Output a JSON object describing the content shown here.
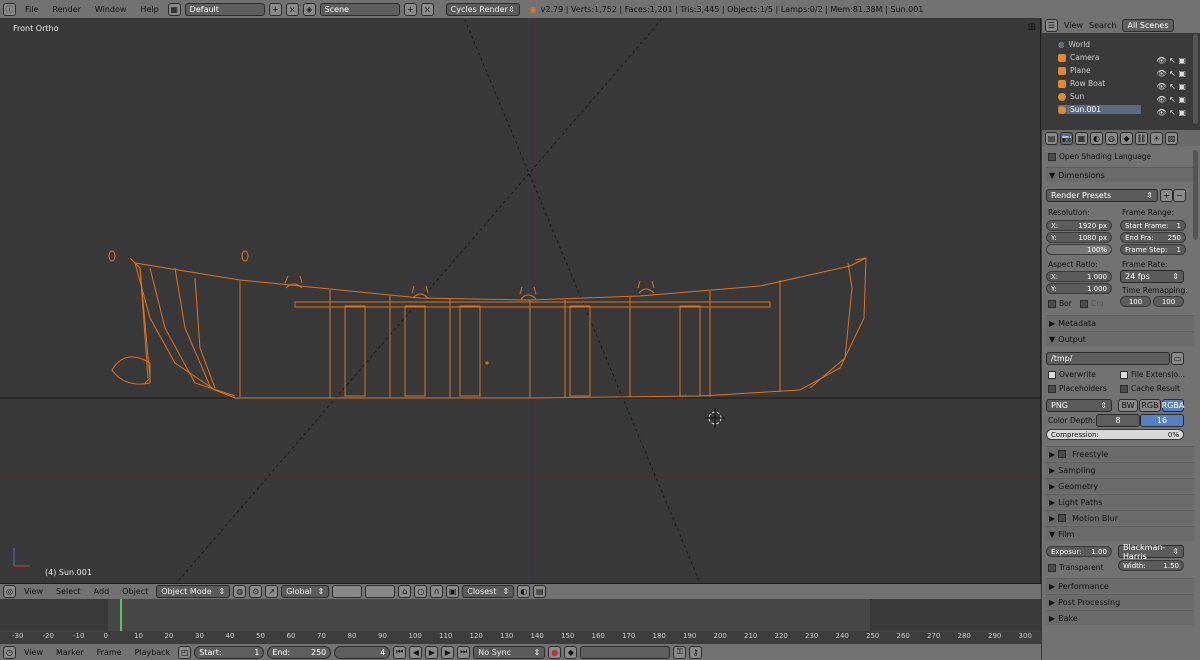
{
  "topbar": {
    "menus": [
      "File",
      "Render",
      "Window",
      "Help"
    ],
    "layout": "Default",
    "scene": "Scene",
    "engine": "Cycles Render",
    "stats": "v2.79 | Verts:1,752 | Faces:1,201 | Tris:3,445 | Objects:1/5 | Lamps:0/2 | Mem:81.38M | Sun.001"
  },
  "viewport": {
    "view_label": "Front Ortho",
    "object_label": "(4) Sun.001"
  },
  "header3d": {
    "menus": [
      "View",
      "Select",
      "Add",
      "Object"
    ],
    "mode": "Object Mode",
    "orientation": "Global",
    "snap": "Closest"
  },
  "timeline": {
    "ticks": [
      "-30",
      "-20",
      "-10",
      "0",
      "10",
      "20",
      "30",
      "40",
      "50",
      "60",
      "70",
      "80",
      "90",
      "100",
      "110",
      "120",
      "130",
      "140",
      "150",
      "160",
      "170",
      "180",
      "190",
      "200",
      "210",
      "220",
      "230",
      "240",
      "250",
      "260",
      "270",
      "280",
      "290",
      "300"
    ],
    "current_frame_pct": 0.115
  },
  "tlheader": {
    "menus": [
      "View",
      "Marker",
      "Frame",
      "Playback"
    ],
    "start_label": "Start:",
    "start_value": "1",
    "end_label": "End:",
    "end_value": "250",
    "current": "4",
    "sync": "No Sync"
  },
  "outliner": {
    "tabs": [
      "View",
      "Search",
      "All Scenes"
    ],
    "items": [
      "World",
      "Camera",
      "Plane",
      "Row Boat",
      "Sun",
      "Sun.001"
    ]
  },
  "props": {
    "osl": "Open Shading Language",
    "dimensions": "Dimensions",
    "render_presets": "Render Presets",
    "resolution": "Resolution:",
    "res_x_label": "X:",
    "res_x": "1920 px",
    "res_y_label": "Y:",
    "res_y": "1080 px",
    "res_pct": "100%",
    "frame_range": "Frame Range:",
    "start_frame_label": "Start Frame:",
    "start_frame": "1",
    "end_frame_label": "End Fra:",
    "end_frame": "250",
    "frame_step_label": "Frame Step:",
    "frame_step": "1",
    "aspect": "Aspect Ratio:",
    "aspect_x_label": "X:",
    "aspect_x": "1.000",
    "aspect_y_label": "Y:",
    "aspect_y": "1.000",
    "frame_rate": "Frame Rate:",
    "fps": "24 fps",
    "time_remap": "Time Remapping:",
    "remap_a": "100",
    "remap_b": "100",
    "bor": "Bor",
    "cro": "Cro",
    "metadata": "Metadata",
    "output": "Output",
    "path": "/tmp/",
    "overwrite": "Overwrite",
    "file_ext": "File Extensio...",
    "placeholders": "Placeholders",
    "cache": "Cache Result",
    "format": "PNG",
    "bw": "BW",
    "rgb": "RGB",
    "rgba": "RGBA",
    "color_depth": "Color Depth:",
    "depth8": "8",
    "depth16": "16",
    "compression_label": "Compression:",
    "compression": "0%",
    "freestyle": "Freestyle",
    "sampling": "Sampling",
    "geometry": "Geometry",
    "light_paths": "Light Paths",
    "motion_blur": "Motion Blur",
    "film": "Film",
    "exposure_label": "Exposur:",
    "exposure": "1.00",
    "filter": "Blackman-Harris",
    "transparent": "Transparent",
    "width_label": "Width:",
    "width": "1.50",
    "performance": "Performance",
    "post": "Post Processing",
    "bake": "Bake"
  },
  "colors": {
    "wire": "#e0731f",
    "accent": "#5680c2",
    "grid": "#2f2f2f"
  }
}
